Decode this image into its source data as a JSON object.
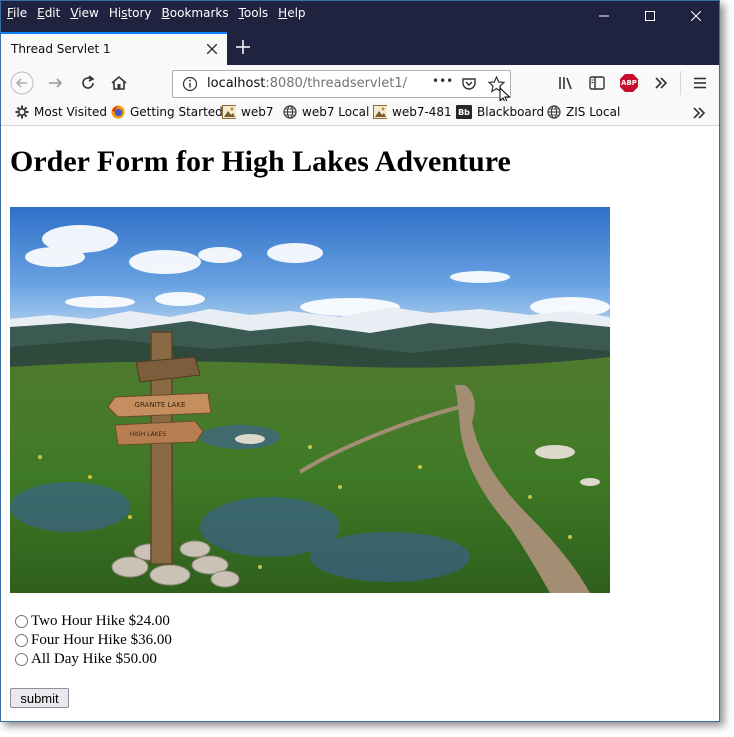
{
  "menu": [
    {
      "key": "F",
      "rest": "ile"
    },
    {
      "key": "E",
      "rest": "dit"
    },
    {
      "key": "V",
      "rest": "iew"
    },
    {
      "pre": "Hi",
      "key": "s",
      "rest": "tory"
    },
    {
      "key": "B",
      "rest": "ookmarks"
    },
    {
      "key": "T",
      "rest": "ools"
    },
    {
      "key": "H",
      "rest": "elp"
    }
  ],
  "tab": {
    "title": "Thread Servlet 1"
  },
  "url": {
    "host": "localhost",
    "rest": ":8080/threadservlet1/",
    "more": "•••"
  },
  "toolbar": {
    "adblock": "ABP"
  },
  "bookmarks": [
    {
      "label": "Most Visited",
      "icon": "gear-icon"
    },
    {
      "label": "Getting Started",
      "icon": "firefox-icon"
    },
    {
      "label": "web7",
      "icon": "image-icon"
    },
    {
      "label": "web7 Local",
      "icon": "globe-icon"
    },
    {
      "label": "web7-481",
      "icon": "image-icon"
    },
    {
      "label": "Blackboard",
      "icon": "blackboard-icon",
      "badge": "Bb"
    },
    {
      "label": "ZIS Local",
      "icon": "globe-icon"
    }
  ],
  "page": {
    "title": "Order Form for High Lakes Adventure",
    "sign": {
      "top": "GRANITE LAKE",
      "bottom": "HIGH LAKES"
    },
    "options": [
      "Two Hour Hike $24.00",
      "Four Hour Hike $36.00",
      "All Day Hike $50.00"
    ],
    "submit": "submit"
  },
  "colors": {
    "titlebar": "#202340",
    "accent": "#0a84ff",
    "abp": "#c70d2c"
  }
}
